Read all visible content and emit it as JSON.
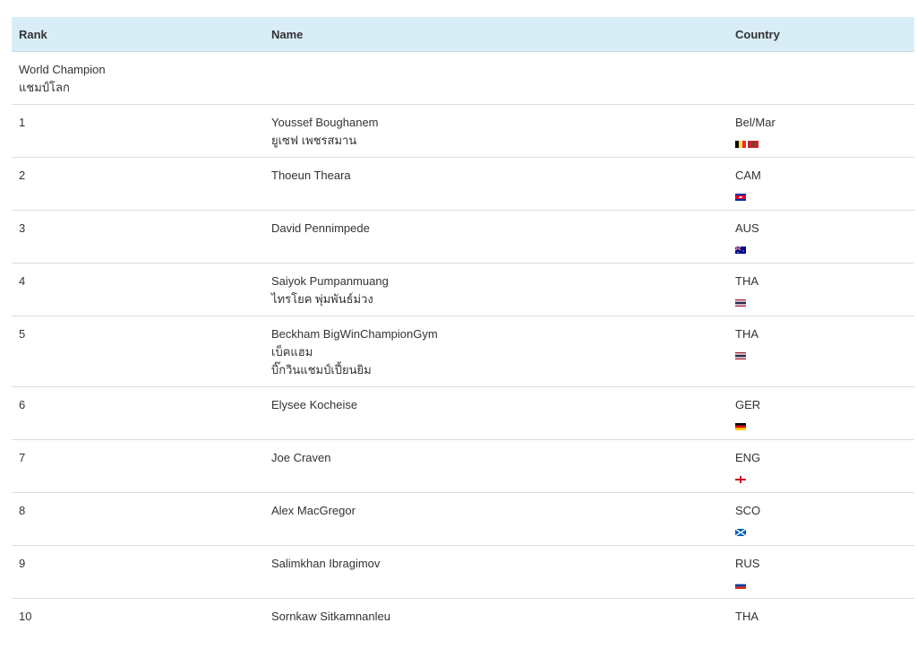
{
  "table": {
    "headers": {
      "rank": "Rank",
      "name": "Name",
      "country": "Country"
    },
    "section": {
      "line1": "World Champion",
      "line2": "แชมป์โลก"
    },
    "rows": [
      {
        "rank": "1",
        "name": [
          "Youssef Boughanem",
          "ยูเซฟ เพชรสมาน"
        ],
        "country": "Bel/Mar",
        "flags": [
          "belgium",
          "morocco"
        ]
      },
      {
        "rank": "2",
        "name": [
          "Thoeun Theara"
        ],
        "country": "CAM",
        "flags": [
          "cambodia"
        ]
      },
      {
        "rank": "3",
        "name": [
          "David Pennimpede"
        ],
        "country": "AUS",
        "flags": [
          "australia"
        ]
      },
      {
        "rank": "4",
        "name": [
          "Saiyok Pumpanmuang",
          "ไทรโยค พุ่มพันธ์ม่วง"
        ],
        "country": "THA",
        "flags": [
          "thailand"
        ]
      },
      {
        "rank": "5",
        "name": [
          "Beckham BigWinChampionGym",
          "เบ็คแฮม",
          "บิ๊กวินแชมป์เปี้ยนยิม"
        ],
        "country": "THA",
        "flags": [
          "thailand"
        ]
      },
      {
        "rank": "6",
        "name": [
          "Elysee Kocheise"
        ],
        "country": "GER",
        "flags": [
          "germany"
        ]
      },
      {
        "rank": "7",
        "name": [
          "Joe Craven"
        ],
        "country": "ENG",
        "flags": [
          "england"
        ]
      },
      {
        "rank": "8",
        "name": [
          "Alex MacGregor"
        ],
        "country": "SCO",
        "flags": [
          "scotland"
        ]
      },
      {
        "rank": "9",
        "name": [
          "Salimkhan Ibragimov"
        ],
        "country": "RUS",
        "flags": [
          "russia"
        ]
      },
      {
        "rank": "10",
        "name": [
          "Sornkaw Sitkamnanleu"
        ],
        "country": "THA",
        "flags": []
      }
    ]
  },
  "colors": {
    "header_bg": "#d9edf7",
    "row_border": "#dddddd",
    "text": "#333333"
  }
}
